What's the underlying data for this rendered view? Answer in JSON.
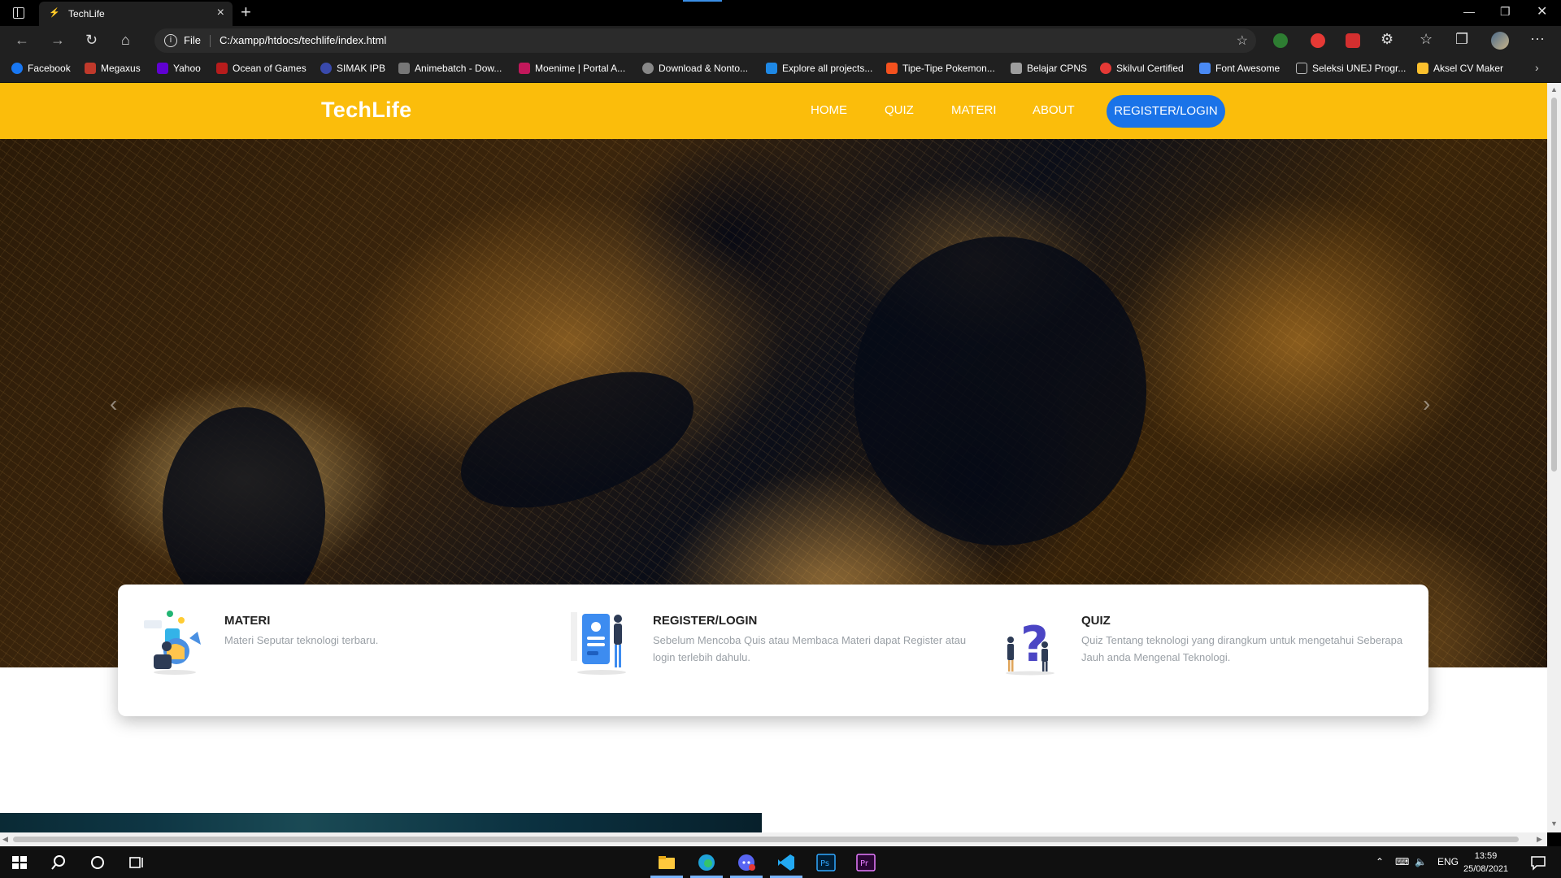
{
  "browser": {
    "tab_title": "TechLife",
    "address_scheme": "File",
    "address_url": "C:/xampp/htdocs/techlife/index.html"
  },
  "bookmarks": [
    {
      "label": "Facebook",
      "color": "#1877f2"
    },
    {
      "label": "Megaxus",
      "color": "#c0392b"
    },
    {
      "label": "Yahoo",
      "color": "#6001d2"
    },
    {
      "label": "Ocean of Games",
      "color": "#b71c1c"
    },
    {
      "label": "SIMAK IPB",
      "color": "#3949ab"
    },
    {
      "label": "Animebatch - Dow...",
      "color": "#777777"
    },
    {
      "label": "Moenime | Portal A...",
      "color": "#c2185b"
    },
    {
      "label": "Download & Nonto...",
      "color": "#888888"
    },
    {
      "label": "Explore all projects...",
      "color": "#1e88e5"
    },
    {
      "label": "Tipe-Tipe Pokemon...",
      "color": "#f4511e"
    },
    {
      "label": "Belajar CPNS",
      "color": "#9e9e9e"
    },
    {
      "label": "Skilvul Certified",
      "color": "#e53935"
    },
    {
      "label": "Font Awesome",
      "color": "#4a8af4"
    },
    {
      "label": "Seleksi UNEJ Progr...",
      "color": "#bbbbbb"
    },
    {
      "label": "Aksel CV Maker",
      "color": "#fbc02d"
    }
  ],
  "site": {
    "brand": "TechLife",
    "nav": {
      "home": "HOME",
      "quiz": "QUIZ",
      "materi": "MATERI",
      "about": "ABOUT",
      "register": "REGISTER/LOGIN"
    },
    "accent_color": "#fbbd0b",
    "button_color": "#1a73e8"
  },
  "features": [
    {
      "title": "MATERI",
      "text": "Materi Seputar teknologi terbaru.",
      "icon": "learning-illustration"
    },
    {
      "title": "REGISTER/LOGIN",
      "text": "Sebelum Mencoba Quis atau Membaca Materi dapat Register atau login terlebih dahulu.",
      "icon": "login-illustration"
    },
    {
      "title": "QUIZ",
      "text": "Quiz Tentang teknologi yang dirangkum untuk mengetahui Seberapa Jauh anda Mengenal Teknologi.",
      "icon": "question-illustration"
    }
  ],
  "taskbar": {
    "language": "ENG",
    "time": "13:59",
    "date": "25/08/2021"
  }
}
